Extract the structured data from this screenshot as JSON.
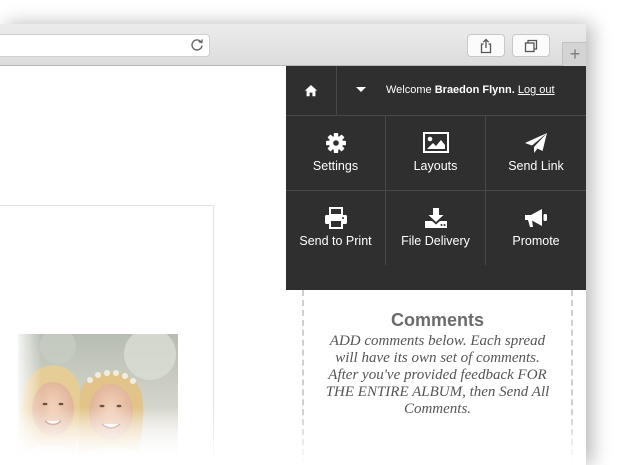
{
  "browser": {
    "icons": {
      "reload": "reload-icon",
      "share": "share-icon",
      "tabs": "tabs-icon",
      "new_tab": "plus-icon"
    },
    "new_tab_label": "+"
  },
  "header": {
    "welcome_prefix": "Welcome",
    "user_name": "Braedon Flynn.",
    "logout_label": "Log out",
    "home_icon": "home-icon",
    "dropdown_icon": "caret-down-icon"
  },
  "menu": {
    "items": [
      {
        "label": "Settings",
        "icon": "gear-icon"
      },
      {
        "label": "Layouts",
        "icon": "image-icon"
      },
      {
        "label": "Send Link",
        "icon": "paper-plane-icon"
      },
      {
        "label": "Send to Print",
        "icon": "printer-icon"
      },
      {
        "label": "File Delivery",
        "icon": "download-icon"
      },
      {
        "label": "Promote",
        "icon": "megaphone-icon"
      }
    ]
  },
  "comments": {
    "title": "Comments",
    "body": "ADD comments below. Each spread will have its own set of comments. After you've provided feedback FOR THE ENTIRE ALBUM, then Send All Comments."
  },
  "colors": {
    "menu_background": "#2f2f2f",
    "menu_divider": "#484848",
    "menu_text": "#ffffff",
    "comments_title": "#6b6b6b",
    "comments_text": "#555555"
  }
}
